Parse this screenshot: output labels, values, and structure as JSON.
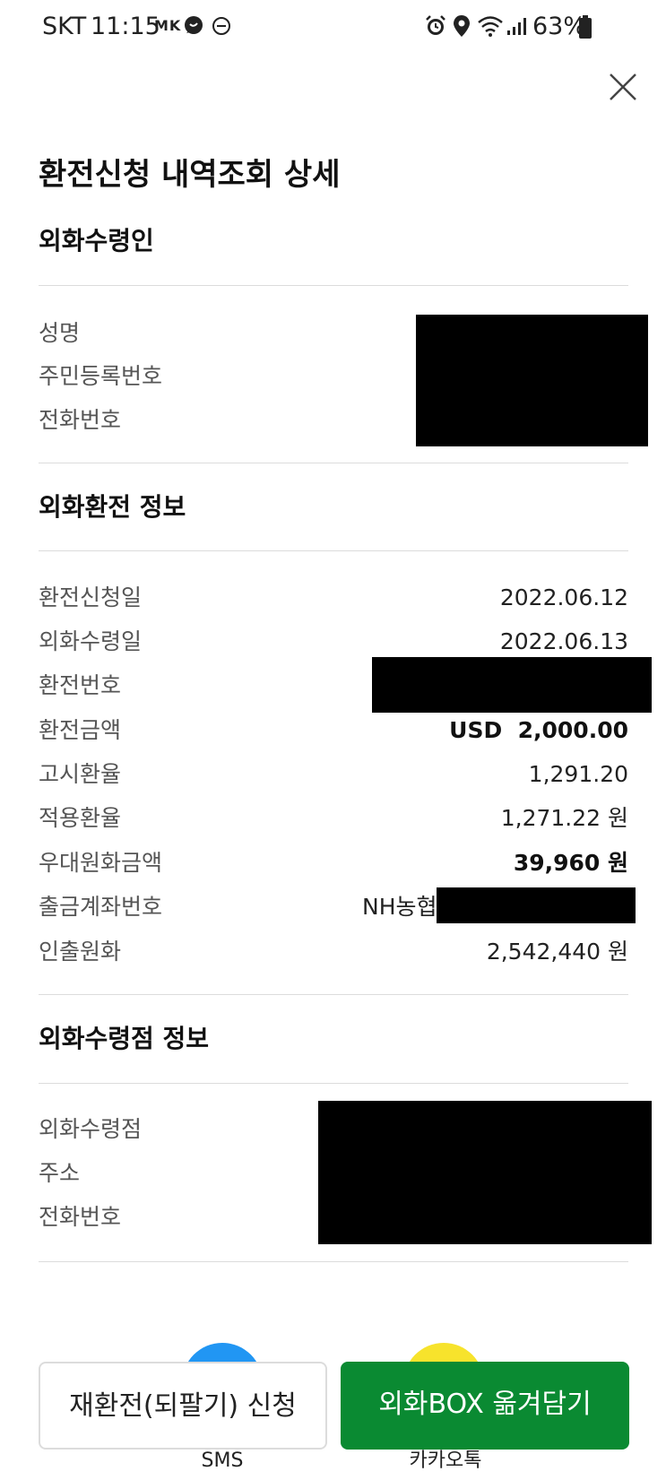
{
  "status_bar": {
    "carrier": "SKT",
    "time": "11:15",
    "mk": "MK",
    "battery": "63%"
  },
  "title": "환전신청 내역조회 상세",
  "recipient": {
    "heading": "외화수령인",
    "labels": [
      "성명",
      "주민등록번호",
      "전화번호"
    ]
  },
  "exchange": {
    "heading": "외화환전 정보",
    "rows": [
      {
        "label": "환전신청일",
        "value": "2022.06.12"
      },
      {
        "label": "외화수령일",
        "value": "2022.06.13"
      },
      {
        "label": "환전번호",
        "value": ""
      },
      {
        "label": "환전금액",
        "value": "USD  2,000.00"
      },
      {
        "label": "고시환율",
        "value": "1,291.20"
      },
      {
        "label": "적용환율",
        "value": "1,271.22 원"
      },
      {
        "label": "우대원화금액",
        "value": "39,960 원"
      },
      {
        "label": "출금계좌번호",
        "value": "NH농협"
      },
      {
        "label": "인출원화",
        "value": "2,542,440 원"
      }
    ]
  },
  "branch": {
    "heading": "외화수령점 정보",
    "labels": [
      "외화수령점",
      "주소",
      "전화번호"
    ]
  },
  "share": {
    "sms": "SMS",
    "kakao": "카카오톡",
    "sms_color": "#2196f3",
    "kakao_color": "#f7e32c"
  },
  "buttons": {
    "reexchange": "재환전(되팔기) 신청",
    "move_box": "외화BOX 옮겨담기",
    "primary_color": "#0a8a32"
  }
}
